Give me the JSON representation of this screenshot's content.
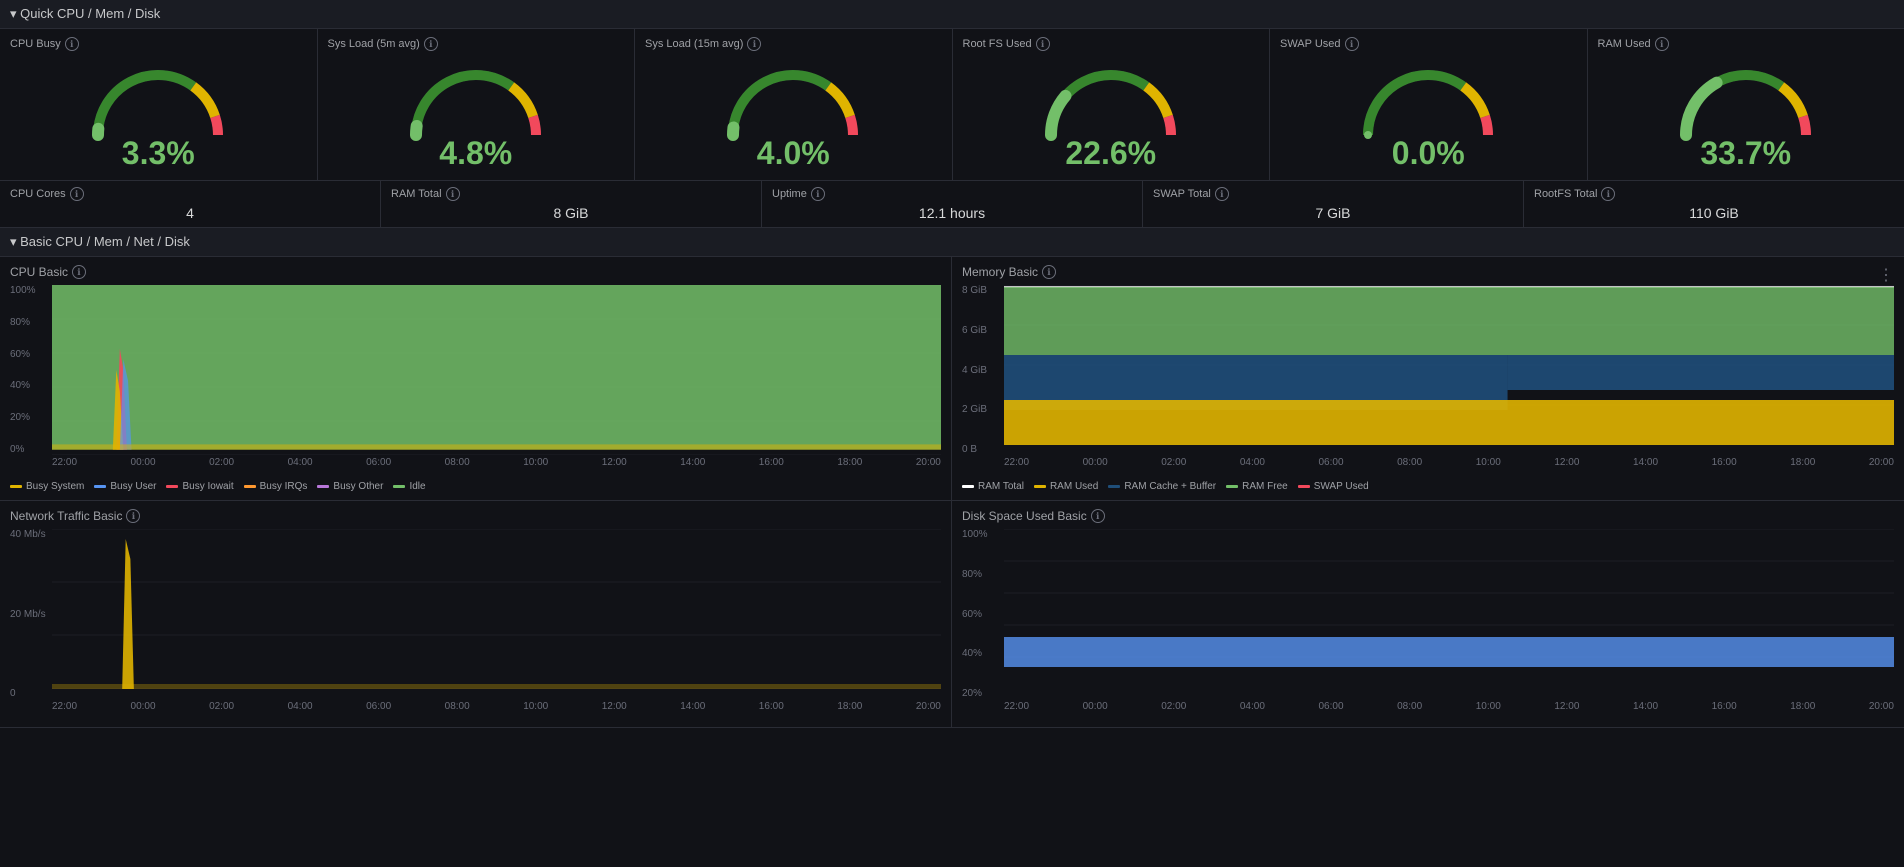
{
  "quick_section": {
    "title": "▾ Quick CPU / Mem / Disk"
  },
  "gauges": [
    {
      "label": "CPU Busy",
      "value": "3.3%",
      "color": "#73bf69",
      "percent": 3.3,
      "arc_color": "#73bf69"
    },
    {
      "label": "Sys Load (5m avg)",
      "value": "4.8%",
      "color": "#73bf69",
      "percent": 4.8,
      "arc_color": "#73bf69"
    },
    {
      "label": "Sys Load (15m avg)",
      "value": "4.0%",
      "color": "#73bf69",
      "percent": 4.0,
      "arc_color": "#73bf69"
    },
    {
      "label": "Root FS Used",
      "value": "22.6%",
      "color": "#73bf69",
      "percent": 22.6,
      "arc_color": "#73bf69"
    },
    {
      "label": "SWAP Used",
      "value": "0.0%",
      "color": "#73bf69",
      "percent": 0,
      "arc_color": "#f2495c"
    },
    {
      "label": "RAM Used",
      "value": "33.7%",
      "color": "#73bf69",
      "percent": 33.7,
      "arc_color": "#73bf69"
    }
  ],
  "stats": [
    {
      "label": "CPU Cores",
      "value": "4"
    },
    {
      "label": "RAM Total",
      "value": "8 GiB"
    },
    {
      "label": "Uptime",
      "value": "12.1 hours"
    },
    {
      "label": "SWAP Total",
      "value": "7 GiB"
    },
    {
      "label": "RootFS Total",
      "value": "110 GiB"
    }
  ],
  "basic_section": {
    "title": "▾ Basic CPU / Mem / Net / Disk"
  },
  "cpu_chart": {
    "title": "CPU Basic",
    "y_labels": [
      "100%",
      "80%",
      "60%",
      "40%",
      "20%",
      "0%"
    ],
    "x_labels": [
      "22:00",
      "00:00",
      "02:00",
      "04:00",
      "06:00",
      "08:00",
      "10:00",
      "12:00",
      "14:00",
      "16:00",
      "18:00",
      "20:00"
    ],
    "legend": [
      {
        "label": "Busy System",
        "color": "#e0b400"
      },
      {
        "label": "Busy User",
        "color": "#5794f2"
      },
      {
        "label": "Busy Iowait",
        "color": "#f2495c"
      },
      {
        "label": "Busy IRQs",
        "color": "#ff9830"
      },
      {
        "label": "Busy Other",
        "color": "#b877d9"
      },
      {
        "label": "Idle",
        "color": "#73bf69"
      }
    ]
  },
  "memory_chart": {
    "title": "Memory Basic",
    "y_labels": [
      "8 GiB",
      "6 GiB",
      "4 GiB",
      "2 GiB",
      "0 B"
    ],
    "x_labels": [
      "22:00",
      "00:00",
      "02:00",
      "04:00",
      "06:00",
      "08:00",
      "10:00",
      "12:00",
      "14:00",
      "16:00",
      "18:00",
      "20:00"
    ],
    "legend": [
      {
        "label": "RAM Total",
        "color": "#ffffff"
      },
      {
        "label": "RAM Used",
        "color": "#e0b400"
      },
      {
        "label": "RAM Cache + Buffer",
        "color": "#1f4e79"
      },
      {
        "label": "RAM Free",
        "color": "#73bf69"
      },
      {
        "label": "SWAP Used",
        "color": "#f2495c"
      }
    ]
  },
  "network_chart": {
    "title": "Network Traffic Basic",
    "y_labels": [
      "40 Mb/s",
      "20 Mb/s",
      "0"
    ],
    "x_labels": [
      "22:00",
      "00:00",
      "02:00",
      "04:00",
      "06:00",
      "08:00",
      "10:00",
      "12:00",
      "14:00",
      "16:00",
      "18:00",
      "20:00"
    ]
  },
  "disk_chart": {
    "title": "Disk Space Used Basic",
    "y_labels": [
      "100%",
      "80%",
      "60%",
      "40%",
      "20%"
    ],
    "x_labels": [
      "22:00",
      "00:00",
      "02:00",
      "04:00",
      "06:00",
      "08:00",
      "10:00",
      "12:00",
      "14:00",
      "16:00",
      "18:00",
      "20:00"
    ]
  },
  "icons": {
    "info": "ℹ",
    "chevron_down": "▾",
    "menu": "⋮"
  }
}
